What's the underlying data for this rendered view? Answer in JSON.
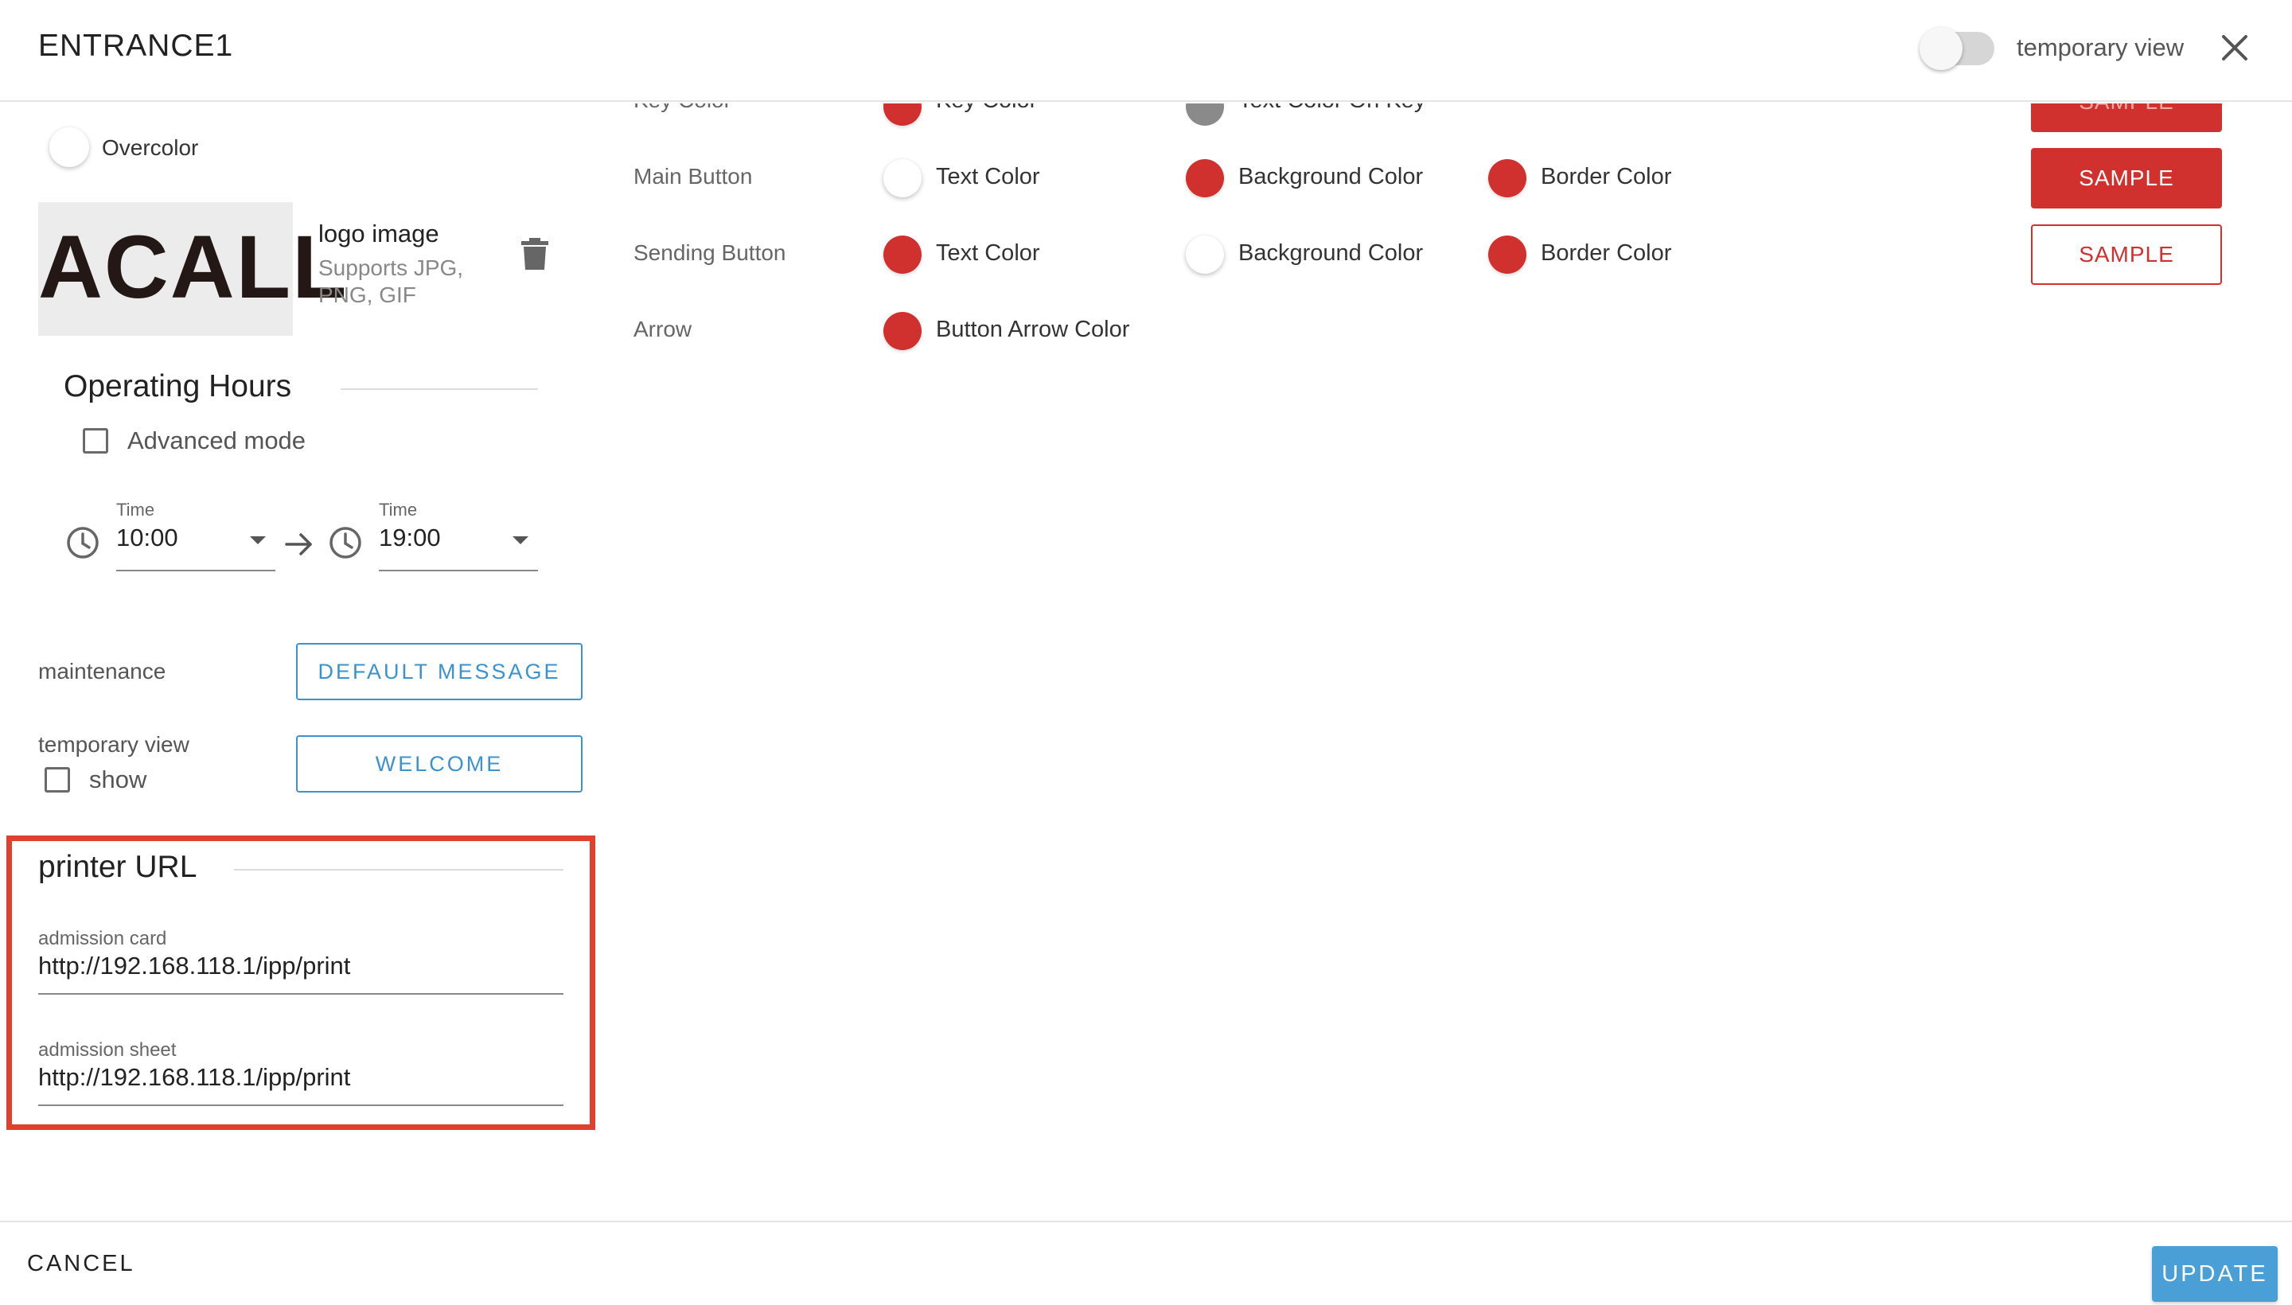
{
  "header": {
    "title": "ENTRANCE1",
    "toggle_label": "temporary view"
  },
  "left": {
    "overcolor_label": "Overcolor",
    "logo": {
      "logo_text": "ACALL",
      "title": "logo image",
      "subtitle": "Supports JPG, PNG, GIF"
    },
    "operating_hours": {
      "title": "Operating Hours",
      "advanced_mode_label": "Advanced mode",
      "start": {
        "label": "Time",
        "value": "10:00"
      },
      "end": {
        "label": "Time",
        "value": "19:00"
      }
    },
    "maintenance": {
      "label": "maintenance",
      "button_label": "DEFAULT MESSAGE"
    },
    "temporary_view": {
      "label": "temporary view",
      "show_label": "show",
      "button_label": "WELCOME"
    },
    "printer_url": {
      "title": "printer URL",
      "admission_card": {
        "label": "admission card",
        "value": "http://192.168.118.1/ipp/print"
      },
      "admission_sheet": {
        "label": "admission sheet",
        "value": "http://192.168.118.1/ipp/print"
      }
    }
  },
  "colors": {
    "key_row": {
      "label": "Key Color",
      "items": [
        {
          "label": "Key Color",
          "color": "#d0302e"
        },
        {
          "label": "Text Color On Key",
          "color": "#8a8a8a"
        }
      ],
      "sample": "SAMPLE"
    },
    "main_button": {
      "label": "Main Button",
      "items": [
        {
          "label": "Text Color",
          "color": "#ffffff"
        },
        {
          "label": "Background Color",
          "color": "#d0302e"
        },
        {
          "label": "Border Color",
          "color": "#d0302e"
        }
      ],
      "sample": "SAMPLE"
    },
    "sending_button": {
      "label": "Sending Button",
      "items": [
        {
          "label": "Text Color",
          "color": "#d0302e"
        },
        {
          "label": "Background Color",
          "color": "#ffffff"
        },
        {
          "label": "Border Color",
          "color": "#d0302e"
        }
      ],
      "sample": "SAMPLE"
    },
    "arrow": {
      "label": "Arrow",
      "items": [
        {
          "label": "Button Arrow Color",
          "color": "#d0302e"
        }
      ]
    }
  },
  "footer": {
    "cancel_label": "CANCEL",
    "update_label": "UPDATE"
  },
  "theme": {
    "accent_blue": "#3a93cf",
    "key_red": "#d0302e",
    "highlight_red": "#e2402e"
  }
}
